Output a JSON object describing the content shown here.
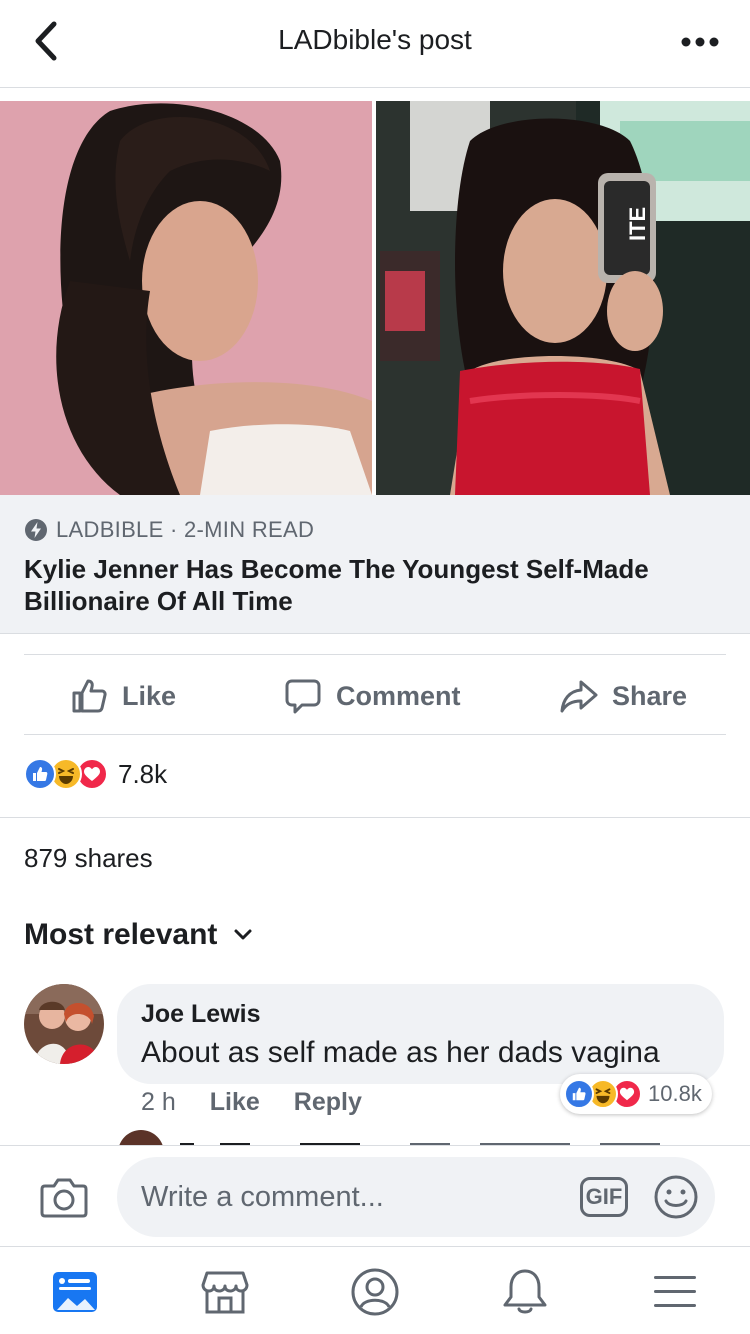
{
  "header": {
    "title": "LADbible's post"
  },
  "link_preview": {
    "source": "LADBIBLE · 2-MIN READ",
    "title": "Kylie Jenner Has Become The Youngest Self-Made Billionaire Of All Time"
  },
  "actions": {
    "like": "Like",
    "comment": "Comment",
    "share": "Share"
  },
  "post_stats": {
    "reaction_count": "7.8k",
    "shares": "879 shares"
  },
  "comments_sort": {
    "label": "Most relevant"
  },
  "comments": [
    {
      "name": "Joe Lewis",
      "text": "About as self made as her dads vagina",
      "time": "2 h",
      "like": "Like",
      "reply": "Reply",
      "reaction_count": "10.8k"
    }
  ],
  "composer": {
    "placeholder": "Write a comment...",
    "gif": "GIF"
  },
  "icons": {
    "back": "chevron-left-icon",
    "more": "more-dots-icon",
    "camera": "camera-icon",
    "emoji": "smiley-icon",
    "nav": [
      "news-feed-icon",
      "marketplace-icon",
      "profile-icon",
      "notifications-icon",
      "menu-icon"
    ]
  },
  "colors": {
    "accent": "#1877f2",
    "text_secondary": "#606770",
    "surface": "#f0f2f5",
    "like_blue": "#3578e5",
    "love_red": "#f0284a",
    "haha_yellow": "#f7b928"
  }
}
